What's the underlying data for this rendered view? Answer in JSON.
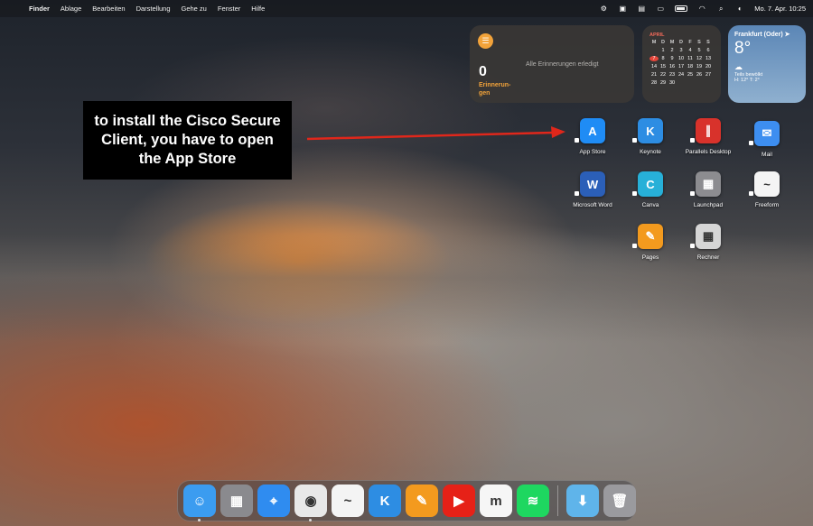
{
  "menubar": {
    "apple_icon": "",
    "items": [
      "Finder",
      "Ablage",
      "Bearbeiten",
      "Darstellung",
      "Gehe zu",
      "Fenster",
      "Hilfe"
    ],
    "datetime": "Mo. 7. Apr.  10:25",
    "status_icons": [
      "vpn-icon",
      "control-icon",
      "notes-icon",
      "display-icon",
      "battery-icon",
      "wifi-icon",
      "search-icon",
      "user-icon"
    ]
  },
  "widgets": {
    "reminders": {
      "count": "0",
      "label": "Erinnerun-\ngen",
      "status": "Alle Erinnerungen erledigt",
      "accent": "#f2a33a"
    },
    "calendar": {
      "month": "APRIL",
      "weekdays": [
        "M",
        "D",
        "M",
        "D",
        "F",
        "S",
        "S"
      ],
      "weeks": [
        [
          "",
          "1",
          "2",
          "3",
          "4",
          "5",
          "6"
        ],
        [
          "7",
          "8",
          "9",
          "10",
          "11",
          "12",
          "13"
        ],
        [
          "14",
          "15",
          "16",
          "17",
          "18",
          "19",
          "20"
        ],
        [
          "21",
          "22",
          "23",
          "24",
          "25",
          "26",
          "27"
        ],
        [
          "28",
          "29",
          "30",
          "",
          "",
          "",
          ""
        ]
      ],
      "today": "7"
    },
    "weather": {
      "city": "Frankfurt (Oder)",
      "temp": "8°",
      "condition": "Teils bewölkt",
      "high_low": "H: 12° T: 2°"
    }
  },
  "desktop_apps": [
    {
      "name": "App Store",
      "icon": "app-store-icon",
      "glyph": "A",
      "color": "#1f8cf5"
    },
    {
      "name": "Keynote",
      "icon": "keynote-icon",
      "glyph": "K",
      "color": "#2d8de3"
    },
    {
      "name": "Parallels Desktop",
      "icon": "parallels-icon",
      "glyph": "∥",
      "color": "#d8322b"
    },
    {
      "name": "Mail",
      "icon": "mail-icon",
      "glyph": "✉",
      "color": "#3d8ef0"
    },
    {
      "name": "Microsoft Word",
      "icon": "word-icon",
      "glyph": "W",
      "color": "#2b5fb8"
    },
    {
      "name": "Canva",
      "icon": "canva-icon",
      "glyph": "C",
      "color": "#27b0d8"
    },
    {
      "name": "Launchpad",
      "icon": "launchpad-icon",
      "glyph": "▦",
      "color": "#8c8c90"
    },
    {
      "name": "Freeform",
      "icon": "freeform-icon",
      "glyph": "~",
      "color": "#f4f4f4"
    },
    {
      "name": "Pages",
      "icon": "pages-icon",
      "glyph": "✎",
      "color": "#f39a1e"
    },
    {
      "name": "Rechner",
      "icon": "calculator-icon",
      "glyph": "▦",
      "color": "#d6d6d6"
    }
  ],
  "annotation": {
    "text": "to install the Cisco Secure Client, you have to open the App Store",
    "arrow_color": "#e0271b"
  },
  "dock": {
    "apps": [
      {
        "name": "finder",
        "icon": "finder-icon",
        "glyph": "☺",
        "color": "#3b9cf0",
        "running": true
      },
      {
        "name": "launchpad",
        "icon": "launchpad-icon",
        "glyph": "▦",
        "color": "#8a8a8e",
        "running": false
      },
      {
        "name": "safari",
        "icon": "safari-icon",
        "glyph": "⌖",
        "color": "#2f8cf0",
        "running": false
      },
      {
        "name": "chrome",
        "icon": "chrome-icon",
        "glyph": "◉",
        "color": "#e8e8e8",
        "running": true
      },
      {
        "name": "freeform",
        "icon": "freeform-icon",
        "glyph": "~",
        "color": "#f4f4f4",
        "running": false
      },
      {
        "name": "keynote",
        "icon": "keynote-icon",
        "glyph": "K",
        "color": "#2d8de3",
        "running": false
      },
      {
        "name": "pages",
        "icon": "pages-icon",
        "glyph": "✎",
        "color": "#f39a1e",
        "running": false
      },
      {
        "name": "youtube",
        "icon": "youtube-icon",
        "glyph": "▶",
        "color": "#e62117",
        "running": false
      },
      {
        "name": "moodle",
        "icon": "moodle-icon",
        "glyph": "m",
        "color": "#f6f6f6",
        "running": false
      },
      {
        "name": "spotify",
        "icon": "spotify-icon",
        "glyph": "≋",
        "color": "#1ed760",
        "running": false
      }
    ],
    "folders": [
      {
        "name": "downloads",
        "icon": "downloads-folder-icon",
        "glyph": "⬇",
        "color": "#5fb4ea"
      },
      {
        "name": "trash",
        "icon": "trash-icon",
        "glyph": "🗑",
        "color": "#9a9a9e"
      }
    ]
  }
}
